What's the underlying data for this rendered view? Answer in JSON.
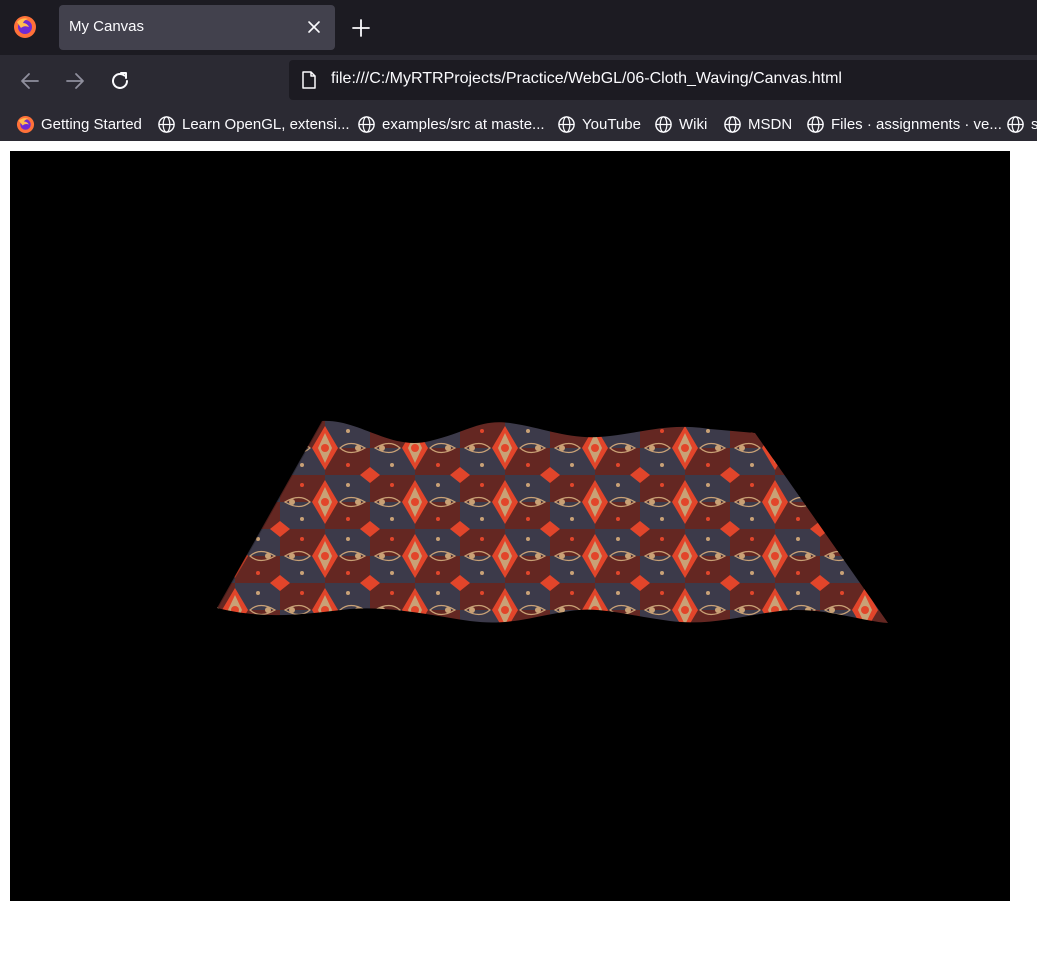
{
  "tabs": [
    {
      "title": "My Canvas",
      "active": true
    }
  ],
  "navbar": {
    "back_icon": "back-arrow-icon",
    "forward_icon": "forward-arrow-icon",
    "reload_icon": "reload-icon",
    "url": "file:///C:/MyRTRProjects/Practice/WebGL/06-Cloth_Waving/Canvas.html"
  },
  "bookmarks": [
    {
      "label": "Getting Started",
      "icon": "firefox-icon"
    },
    {
      "label": "Learn OpenGL, extensi...",
      "icon": "globe-icon"
    },
    {
      "label": "examples/src at maste...",
      "icon": "globe-icon"
    },
    {
      "label": "YouTube",
      "icon": "globe-icon"
    },
    {
      "label": "Wiki",
      "icon": "globe-icon"
    },
    {
      "label": "MSDN",
      "icon": "globe-icon"
    },
    {
      "label": "Files · assignments · ve...",
      "icon": "globe-icon"
    },
    {
      "label": "s",
      "icon": "globe-icon"
    }
  ],
  "colors": {
    "tabstrip_bg": "#1c1b22",
    "toolbar_bg": "#2b2a33",
    "active_tab_bg": "#42414d",
    "text": "#fbfbfe",
    "canvas_bg": "#000000",
    "cloth_dark": "#3c3a4a",
    "cloth_red": "#e2452a",
    "cloth_maroon": "#6b231b",
    "cloth_tan": "#c9a176"
  },
  "canvas": {
    "content": "textured waving cloth (ornate rug pattern)"
  }
}
